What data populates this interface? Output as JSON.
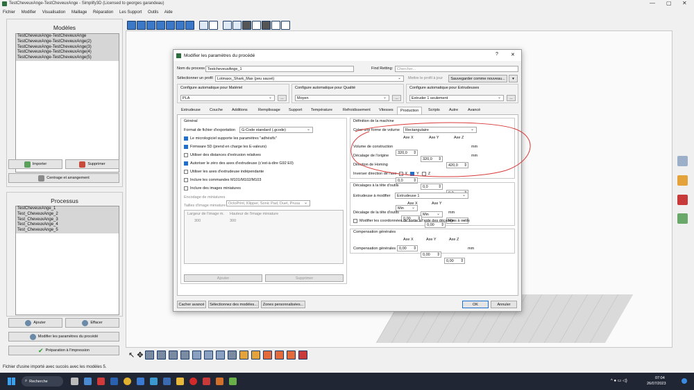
{
  "window": {
    "title": "TestCheveuxAnge-TestCheveuxAnge - Simplify3D (Licensed to georges garandeau)"
  },
  "menu": [
    "Fichier",
    "Modifier",
    "Visualisation",
    "Maillage",
    "Réparation",
    "Les Support",
    "Outils",
    "Aide"
  ],
  "models": {
    "title": "Modèles",
    "items": [
      "TestCheveuxAnge-TestCheveuxAnge",
      "TestCheveuxAnge-TestCheveuxAnge(2)",
      "TestCheveuxAnge-TestCheveuxAnge(3)",
      "TestCheveuxAnge-TestCheveuxAnge(4)",
      "TestCheveuxAnge-TestCheveuxAnge(5)"
    ],
    "import_label": "Importer",
    "delete_label": "Supprimer",
    "center_label": "Centrage et arrangement"
  },
  "processes": {
    "title": "Processus",
    "items": [
      "TestCheveuxAnge_1",
      "Test_CheveuxAnge_2",
      "Test_CheveuxAnge_3",
      "Test_CheveuxAnge_4",
      "Test_CheveuxAnge_5"
    ],
    "add_label": "Ajouter",
    "remove_label": "Effacer",
    "edit_label": "Modifier les paramètres du procédé",
    "prepare_label": "Préparation à l'impression"
  },
  "status": "Fichier d'usine importé avec succès avec les modèles 5.",
  "dialog": {
    "title": "Modifier les paramètres du procédé",
    "help": "?",
    "close": "✕",
    "process_name_label": "Nom du process",
    "process_name_value": "TestcheveuxAnge_1",
    "find_label": "Find Retting:",
    "find_placeholder": "Chercher...",
    "profile_label": "Sélectionner un profil",
    "profile_value": "Lotmaxx_Shark_Max (peu sauvé)",
    "update_profile_label": "Mettre le profil à jour",
    "save_as_label": "Sauvegarder comme nouveau...",
    "material_label": "Configure automatique pour Matériel",
    "material_value": "PLA",
    "quality_label": "Configure automatique pour Qualité",
    "quality_value": "Moyen",
    "extruder_label": "Configure automatique pour Extrudeuses",
    "extruder_value": "Extruder 1 seulement",
    "more": "...",
    "tabs": [
      "Extrudeuse",
      "Couche",
      "Additions",
      "Remplissage",
      "Support",
      "Température",
      "Refroidissement",
      "Vitesses",
      "Production",
      "Scripts",
      "Autre",
      "Avancé"
    ],
    "active_tab": "Production",
    "general": {
      "title": "Général",
      "export_label": "Format de fichier d'exportation",
      "export_value": "G-Code standard (.gcode)",
      "checks": [
        {
          "label": "Le micrologiciel supporte les paramètres \"adhésifs\"",
          "checked": true
        },
        {
          "label": "Firmware 5D (prend en charge les E-valeurs)",
          "checked": true
        },
        {
          "label": "Utiliser des distances d'extrusion relatives",
          "checked": false
        },
        {
          "label": "Autoriser le zéro des axes d'extrudeuse (c'est-à-dire G92 E0)",
          "checked": true
        },
        {
          "label": "Utiliser les axes d'extrudeuse indépendante",
          "checked": false
        },
        {
          "label": "Inclure les commandes M101/M102/M103",
          "checked": false
        },
        {
          "label": "Inclure des images miniatures",
          "checked": false
        }
      ],
      "thumb_encoding_label": "Encodage de miniatures",
      "thumb_encoding_value": "OctoPrint, Klipper, Sonic Pad, Duet, Prusa",
      "thumb_sizes_label": "Tailles d'image miniature",
      "thumb_cols": [
        "Largeur de l'image m.",
        "Hauteur de l'image miniature"
      ],
      "thumb_row": [
        "300",
        "300"
      ],
      "add_label": "Ajouter",
      "delete_label": "Supprimer"
    },
    "machine": {
      "title": "Définition de la machine",
      "volume_shape_label": "Créer une forme de volume",
      "volume_shape_value": "Rectangulaire",
      "axes": [
        "Axe X",
        "Axe Y",
        "Axe Z"
      ],
      "build_volume_label": "Volume de construction",
      "build_volume": [
        "320,0",
        "320,0",
        "420,0"
      ],
      "origin_label": "Décalage de l'origine",
      "origin": [
        "0,0",
        "0,0",
        "0,0"
      ],
      "homing_label": "Direction de Homing",
      "homing": [
        "Min",
        "Min",
        "Min"
      ],
      "invert_label": "Inverser direction de l'axe",
      "invert": [
        {
          "axis": "X",
          "checked": false
        },
        {
          "axis": "Y",
          "checked": true
        },
        {
          "axis": "Z",
          "checked": false
        }
      ],
      "unit": "mm"
    },
    "head_offset": {
      "title": "Décalages à la tête d'outils",
      "extruder_label": "Extrudeuse à modifier",
      "extruder_value": "Extrudeuse 1",
      "axes": [
        "Axe X",
        "Axe Y"
      ],
      "offset_label": "Décalage de la tête d'outils",
      "values": [
        "0,00",
        "0,00"
      ],
      "unit": "mm",
      "modify_coords_label": "Modifier les coordonnées de sortie à l'aide des décalages à outils"
    },
    "compensation": {
      "title": "Compensation générales",
      "axes": [
        "Axe X",
        "Axe Y",
        "Axe Z"
      ],
      "label": "Compensation générales",
      "values": [
        "0,00",
        "0,00",
        "0,00"
      ],
      "unit": "mm"
    },
    "footer": {
      "cancel_adv": "Cacher avancé",
      "select_models": "Sélectionnez des modèles...",
      "custom_zones": "Zones personnalisées...",
      "ok": "OK",
      "cancel": "Annuler"
    }
  },
  "taskbar": {
    "search": "Recherche",
    "time": "07:04",
    "date": "26/07/2023"
  },
  "colors": {
    "accent": "#1d6fd0",
    "annotation": "#d93a3a",
    "toolbar_blue": "#3c78c8"
  }
}
